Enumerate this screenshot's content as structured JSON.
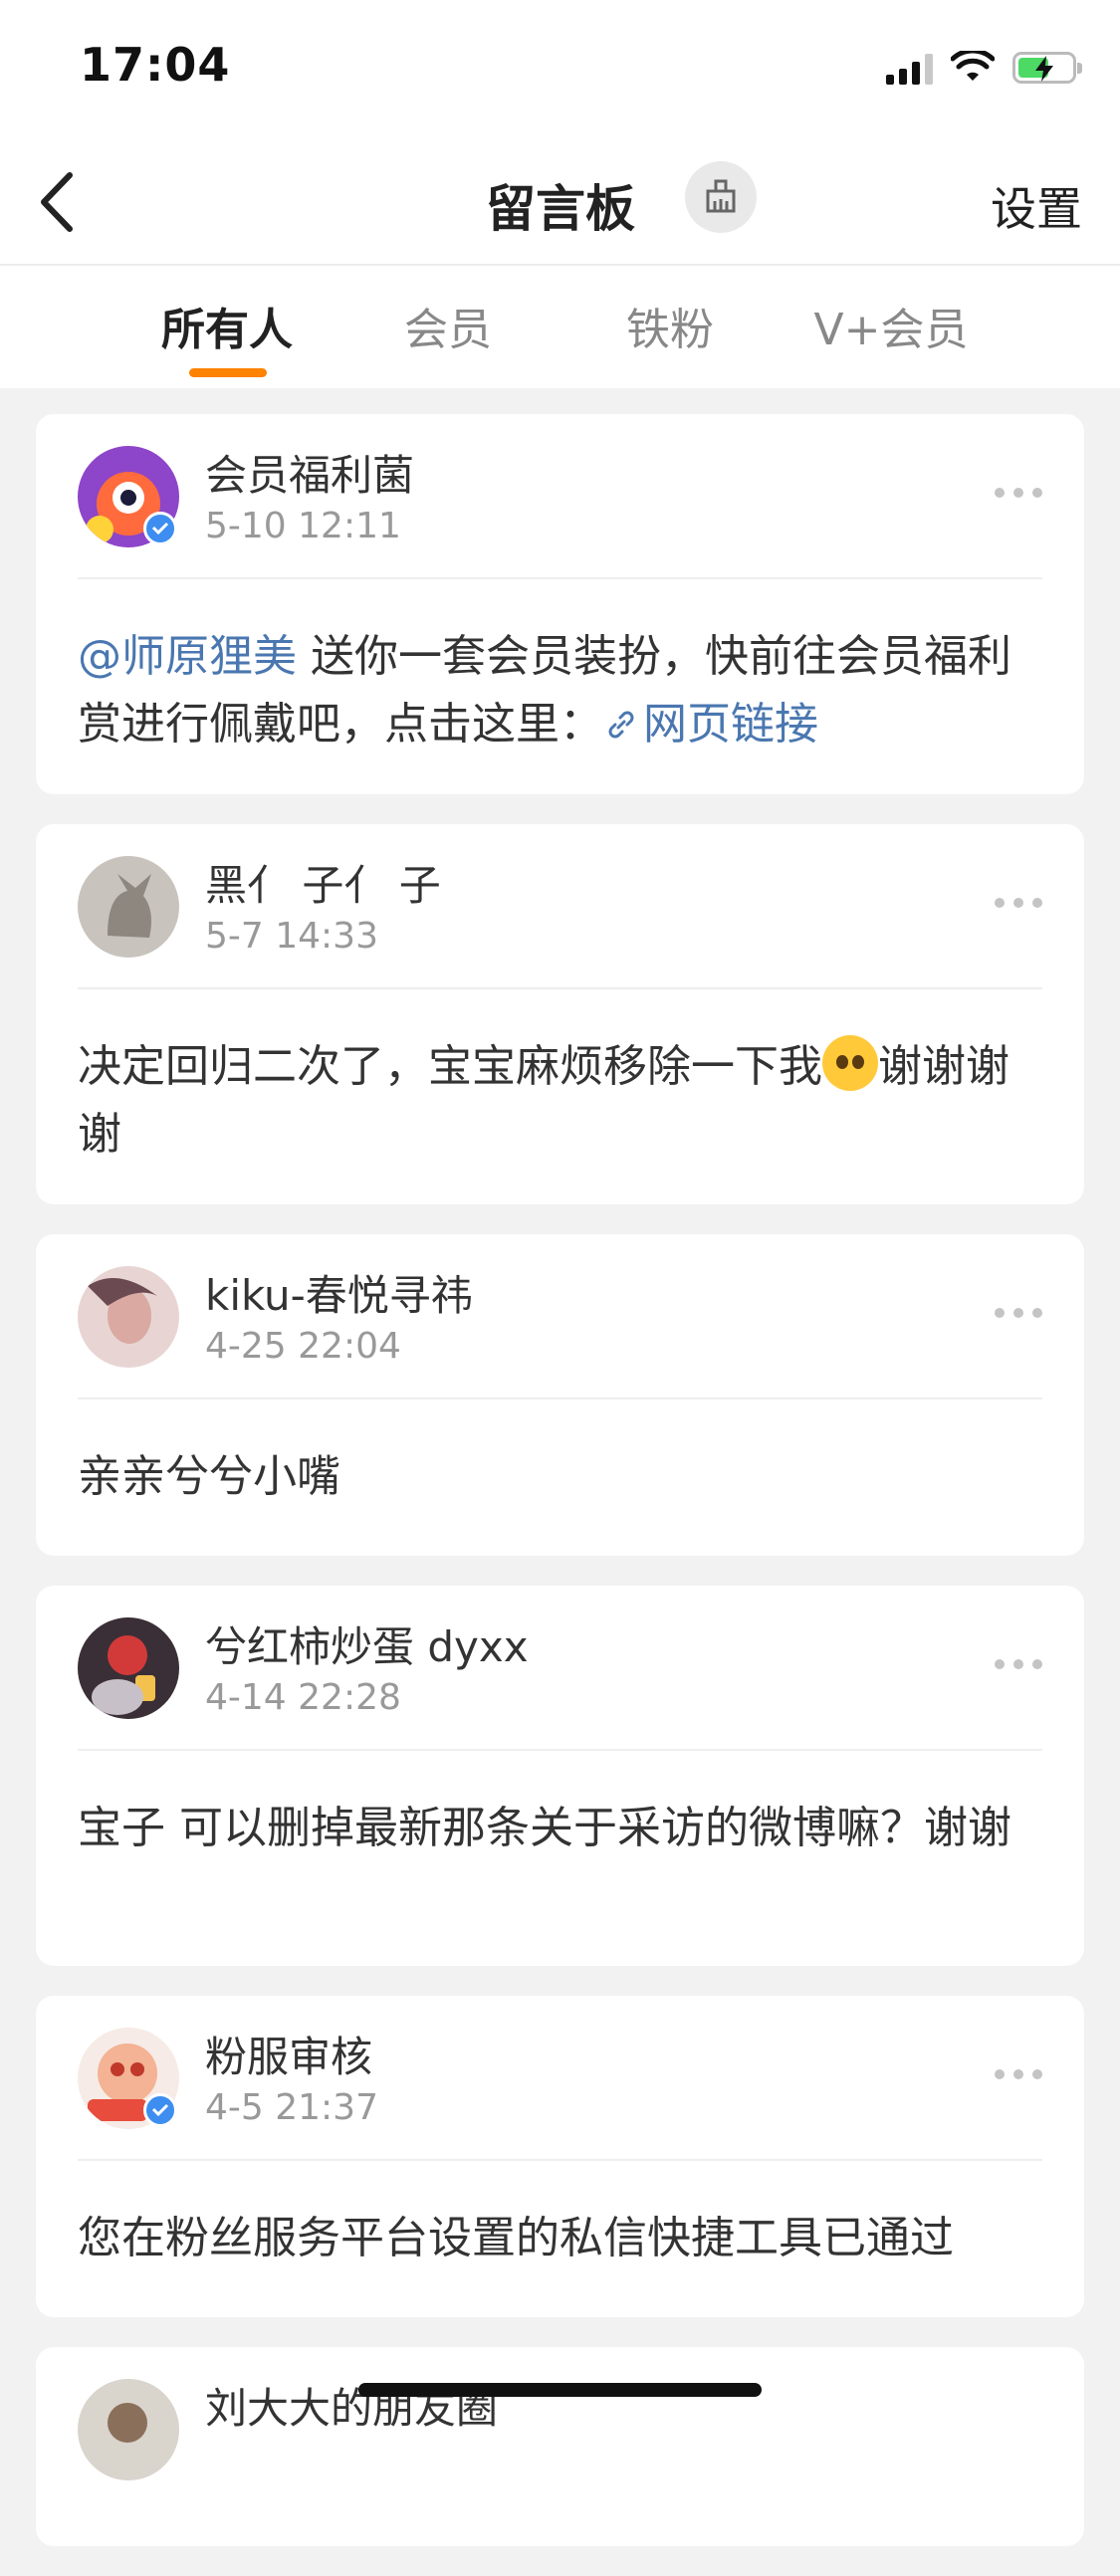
{
  "status_bar": {
    "time": "17:04"
  },
  "header": {
    "title": "留言板",
    "settings_label": "设置"
  },
  "tabs": [
    {
      "label": "所有人",
      "active": true
    },
    {
      "label": "会员",
      "active": false
    },
    {
      "label": "铁粉",
      "active": false
    },
    {
      "label": "V+会员",
      "active": false
    }
  ],
  "colors": {
    "accent": "#ff8200",
    "link": "#4a77b0",
    "verified": "#3d8ef0"
  },
  "messages": [
    {
      "name": "会员福利菌",
      "date": "5-10 12:11",
      "verified": true,
      "mention": "@师原狸美",
      "text": " 送你一套会员装扮，快前往会员福利赏进行佩戴吧，点击这里：",
      "link_label": "网页链接"
    },
    {
      "name": "黑亻 子亻 子",
      "date": "5-7 14:33",
      "verified": false,
      "text_before_emoji": "决定回归二次了，宝宝麻烦移除一下我",
      "text_after_emoji": "谢谢谢谢"
    },
    {
      "name": "kiku-春悦寻祎",
      "date": "4-25 22:04",
      "verified": false,
      "text": "亲亲兮兮小嘴"
    },
    {
      "name": "兮红柿炒蛋 dyxx",
      "date": "4-14 22:28",
      "verified": false,
      "text": "宝子 可以删掉最新那条关于采访的微博嘛？谢谢"
    },
    {
      "name": "粉服审核",
      "date": "4-5 21:37",
      "verified": true,
      "text": "您在粉丝服务平台设置的私信快捷工具已通过"
    },
    {
      "name": "刘大大的朋友圈"
    }
  ]
}
